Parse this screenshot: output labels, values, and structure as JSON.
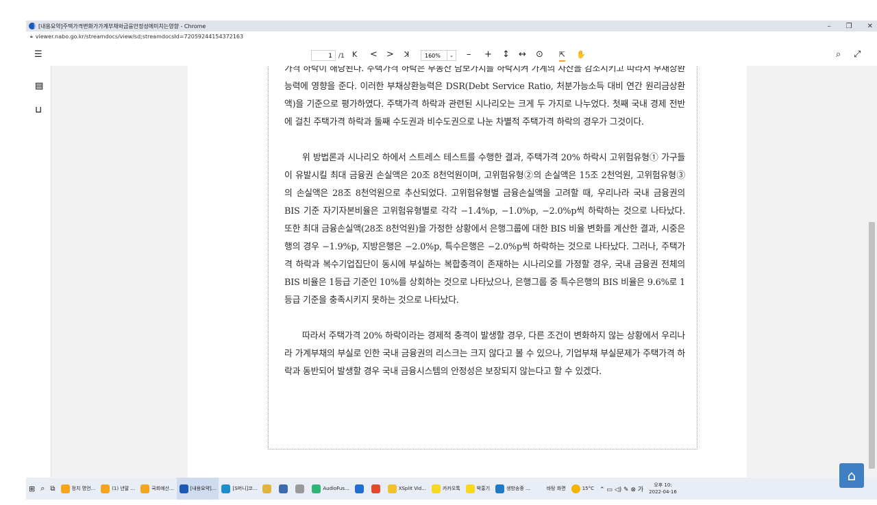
{
  "window": {
    "title": "[내용요약]주택가격변화가가계부채와금융안정성에미치는영향 - Chrome",
    "minimize": "–",
    "maximize": "❐",
    "close": "✕"
  },
  "address": {
    "url": "viewer.nabo.go.kr/streamdocs/view/sd;streamdocsId=72059244154372163"
  },
  "toolbar": {
    "menu_icon": "☰",
    "page_current": "1",
    "page_total": "/1",
    "first": "K",
    "prev": "<",
    "next": ">",
    "last": "ꓘ",
    "zoom": "160%",
    "zoom_chevron": "⌄",
    "zoom_out": "–",
    "zoom_in": "+",
    "fit_height": "↕",
    "fit_width": "↔",
    "more": "⊙",
    "select_tool": "⇱",
    "hand_tool": "✋",
    "search": "⌕",
    "fullscreen": "⤢"
  },
  "sidebar": {
    "thumbnail_icon": "▤",
    "bookmark_icon": "⊓",
    "expand": "›"
  },
  "document": {
    "paragraphs": [
      "가격 하락이 해당된다. 주택가격 하락은 부동산 담보가치를 하락시켜 가계의 자산을 감소시키고 따라서 부채상환능력에 영향을 준다. 이러한 부채상환능력은 DSR(Debt Service Ratio, 처분가능소득 대비 연간 원리금상환액)을 기준으로 평가하였다. 주택가격 하락과 관련된 시나리오는 크게 두 가지로 나누었다. 첫째 국내 경제 전반에 걸친 주택가격 하락과 둘째 수도권과 비수도권으로 나눈 차별적 주택가격 하락의 경우가 그것이다.",
      "위 방법론과 시나리오 하에서 스트레스 테스트를 수행한 결과, 주택가격 20% 하락시 고위험유형① 가구들이 유발시킬 최대 금융권 손실액은 20조 8천억원이며, 고위험유형②의 손실액은 15조 2천억원, 고위험유형③의 손실액은 28조 8천억원으로 추산되었다. 고위험유형별 금융손실액을 고려할 때, 우리나라 국내 금융권의 BIS 기준 자기자본비율은 고위험유형별로 각각 −1.4%p, −1.0%p, −2.0%p씩 하락하는 것으로 나타났다. 또한 최대 금융손실액(28조 8천억원)을 가정한 상황에서 은행그룹에 대한 BIS 비율 변화를 계산한 결과, 시중은행의 경우 −1.9%p, 지방은행은 −2.0%p, 특수은행은 −2.0%p씩 하락하는 것으로 나타났다. 그러나, 주택가격 하락과 복수기업집단이 동시에 부실하는 복합충격이 존재하는 시나리오를 가정할 경우, 국내 금융권 전체의 BIS 비율은 1등급 기준인 10%를 상회하는 것으로 나타났으나, 은행그룹 중 특수은행의 BIS 비율은 9.6%로 1등급 기준을 충족시키지 못하는 것으로 나타났다.",
      "따라서 주택가격 20% 하락이라는 경제적 충격이 발생할 경우, 다른 조건이 변화하지 않는 상황에서 우리나라 가계부채의 부실로 인한 국내 금융권의 리스크는 크지 않다고 볼 수 있으나, 기업부채 부실문제가 주택가격 하락과 동반되어 발생할 경우 국내 금융시스템의 안정성은 보장되지 않는다고 할 수 있겠다."
    ]
  },
  "taskbar": {
    "items": [
      {
        "label": "정치 명언...",
        "color": "#f4a51c"
      },
      {
        "label": "(1) 년말 ...",
        "color": "#f4a51c"
      },
      {
        "label": "국회예산...",
        "color": "#f4a51c"
      },
      {
        "label": "[내용요약]...",
        "color": "#1c58b8"
      },
      {
        "label": "[S머니]코...",
        "color": "#1f8fc9"
      },
      {
        "label": "",
        "color": "#e0b53a"
      },
      {
        "label": "",
        "color": "#3b6cb0"
      },
      {
        "label": "",
        "color": "#9a9a9a"
      },
      {
        "label": "AudioFus...",
        "color": "#2fb574"
      },
      {
        "label": "",
        "color": "#1f6fd0"
      },
      {
        "label": "",
        "color": "#e34a2c"
      },
      {
        "label": "XSplit Vid...",
        "color": "#f3c12b"
      },
      {
        "label": "카카오톡",
        "color": "#f8d81a"
      },
      {
        "label": "박홍기",
        "color": "#f8d81a"
      },
      {
        "label": "생방송중 ...",
        "color": "#1f7ac9"
      },
      {
        "label": "바탕 화면",
        "color": "#e9eef6"
      }
    ],
    "weather": "15°C",
    "time": "오후 10:",
    "date": "2022-04-16"
  },
  "colors": {
    "accent": "#1c58b8",
    "tool_underline": "#f0a030"
  }
}
